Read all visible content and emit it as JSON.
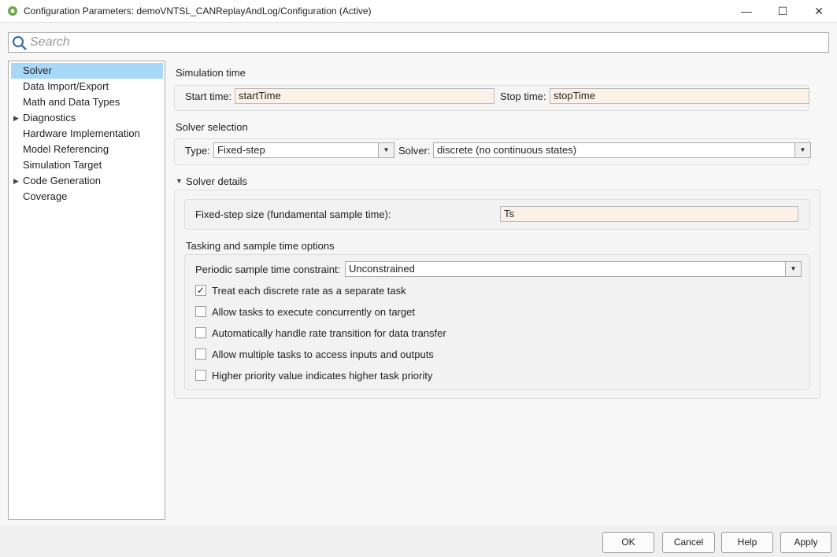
{
  "window": {
    "title": "Configuration Parameters: demoVNTSL_CANReplayAndLog/Configuration (Active)",
    "minimize": "—",
    "maximize": "☐",
    "close": "✕"
  },
  "search": {
    "placeholder": "Search"
  },
  "sidebar": {
    "items": [
      {
        "label": "Solver",
        "selected": true,
        "expandable": false
      },
      {
        "label": "Data Import/Export",
        "expandable": false
      },
      {
        "label": "Math and Data Types",
        "expandable": false
      },
      {
        "label": "Diagnostics",
        "expandable": true
      },
      {
        "label": "Hardware Implementation",
        "expandable": false
      },
      {
        "label": "Model Referencing",
        "expandable": false
      },
      {
        "label": "Simulation Target",
        "expandable": false
      },
      {
        "label": "Code Generation",
        "expandable": true
      },
      {
        "label": "Coverage",
        "expandable": false
      }
    ]
  },
  "sim_time": {
    "heading": "Simulation time",
    "start_label": "Start time:",
    "start_value": "startTime",
    "stop_label": "Stop time:",
    "stop_value": "stopTime"
  },
  "solver_sel": {
    "heading": "Solver selection",
    "type_label": "Type:",
    "type_value": "Fixed-step",
    "solver_label": "Solver:",
    "solver_value": "discrete (no continuous states)"
  },
  "details": {
    "heading": "Solver details",
    "step_label": "Fixed-step size (fundamental sample time):",
    "step_value": "Ts",
    "tasking_heading": "Tasking and sample time options",
    "periodic_label": "Periodic sample time constraint:",
    "periodic_value": "Unconstrained",
    "checkboxes": [
      {
        "label": "Treat each discrete rate as a separate task",
        "checked": true
      },
      {
        "label": "Allow tasks to execute concurrently on target",
        "checked": false
      },
      {
        "label": "Automatically handle rate transition for data transfer",
        "checked": false
      },
      {
        "label": "Allow multiple tasks to access inputs and outputs",
        "checked": false
      },
      {
        "label": "Higher priority value indicates higher task priority",
        "checked": false
      }
    ]
  },
  "buttons": {
    "ok": "OK",
    "cancel": "Cancel",
    "help": "Help",
    "apply": "Apply"
  }
}
